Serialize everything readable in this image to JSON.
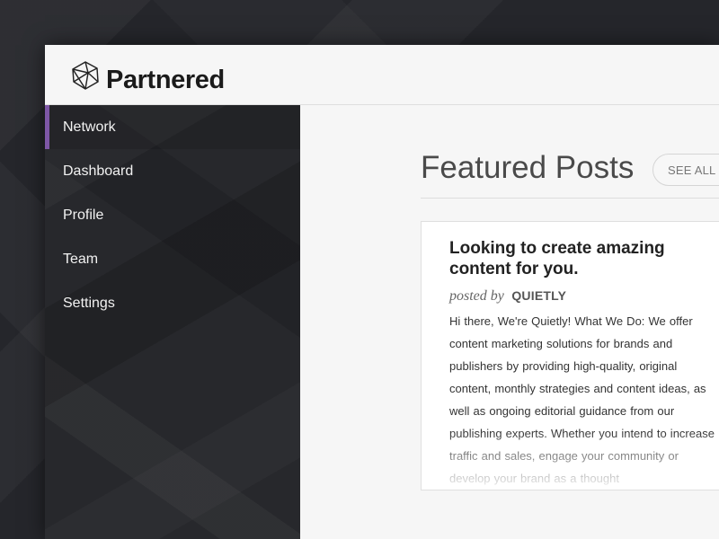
{
  "brand": {
    "name": "Partnered",
    "logo_icon": "geodesic-logo-icon"
  },
  "sidebar": {
    "items": [
      {
        "label": "Network",
        "active": true
      },
      {
        "label": "Dashboard",
        "active": false
      },
      {
        "label": "Profile",
        "active": false
      },
      {
        "label": "Team",
        "active": false
      },
      {
        "label": "Settings",
        "active": false
      }
    ]
  },
  "main": {
    "section_title": "Featured Posts",
    "see_all_label": "SEE ALL",
    "see_all_icon": "x-icon",
    "featured_post": {
      "title": "Looking to create amazing content for you.",
      "posted_by_label": "posted by",
      "author": "QUIETLY",
      "excerpt": "Hi there,   We're Quietly!   What We Do: We offer content marketing solutions for brands and publishers by providing high-quality, original content, monthly strategies and content ideas, as well as ongoing editorial guidance from our publishing experts. Whether you intend to increase traffic and sales, engage your community or develop your brand as a thought"
    }
  },
  "colors": {
    "background": "#25262b",
    "sidebar_background": "#27282c",
    "active_indicator": "#7e57a6",
    "content_background": "#f6f6f6"
  }
}
